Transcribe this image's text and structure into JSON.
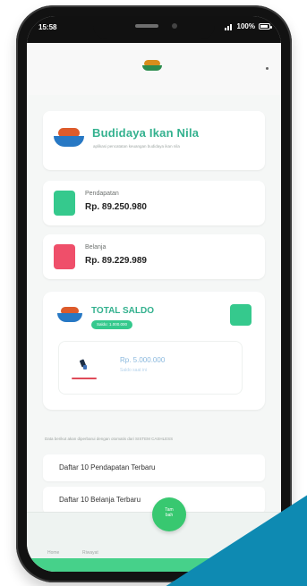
{
  "status_bar": {
    "time": "15:58",
    "battery": "100%"
  },
  "hero": {
    "title": "Budidaya Ikan Nila",
    "subtitle": "aplikasi pencatatan keuangan budidaya ikan nila"
  },
  "summary": {
    "income_label": "Pendapatan",
    "income_value": "Rp. 89.250.980",
    "expense_label": "Belanja",
    "expense_value": "Rp. 89.229.989"
  },
  "total_card": {
    "title": "TOTAL SALDO",
    "pill": "Saldo: 1.000.000",
    "amount": "Rp. 5.000.000",
    "caption": "Saldo saat ini"
  },
  "notice": {
    "text": "Data berikut akan diperbarui dengan otomatis dari SISTEM CASHLESS"
  },
  "lists": {
    "income": "Daftar 10 Pendapatan Terbaru",
    "expense": "Daftar 10 Belanja Terbaru"
  },
  "bottom_nav": {
    "home": "Home",
    "history": "Riwayat",
    "fab": "Tam\nbah"
  },
  "colors": {
    "accent": "#33b18e",
    "income": "#35c98d",
    "expense": "#ef4f6a",
    "fab": "#38c870",
    "corner": "#0e8ab2"
  },
  "icons": {
    "signal": "signal-icon",
    "battery": "battery-icon",
    "logo": "fish-bowl-icon",
    "wallet": "wallet-icon"
  }
}
